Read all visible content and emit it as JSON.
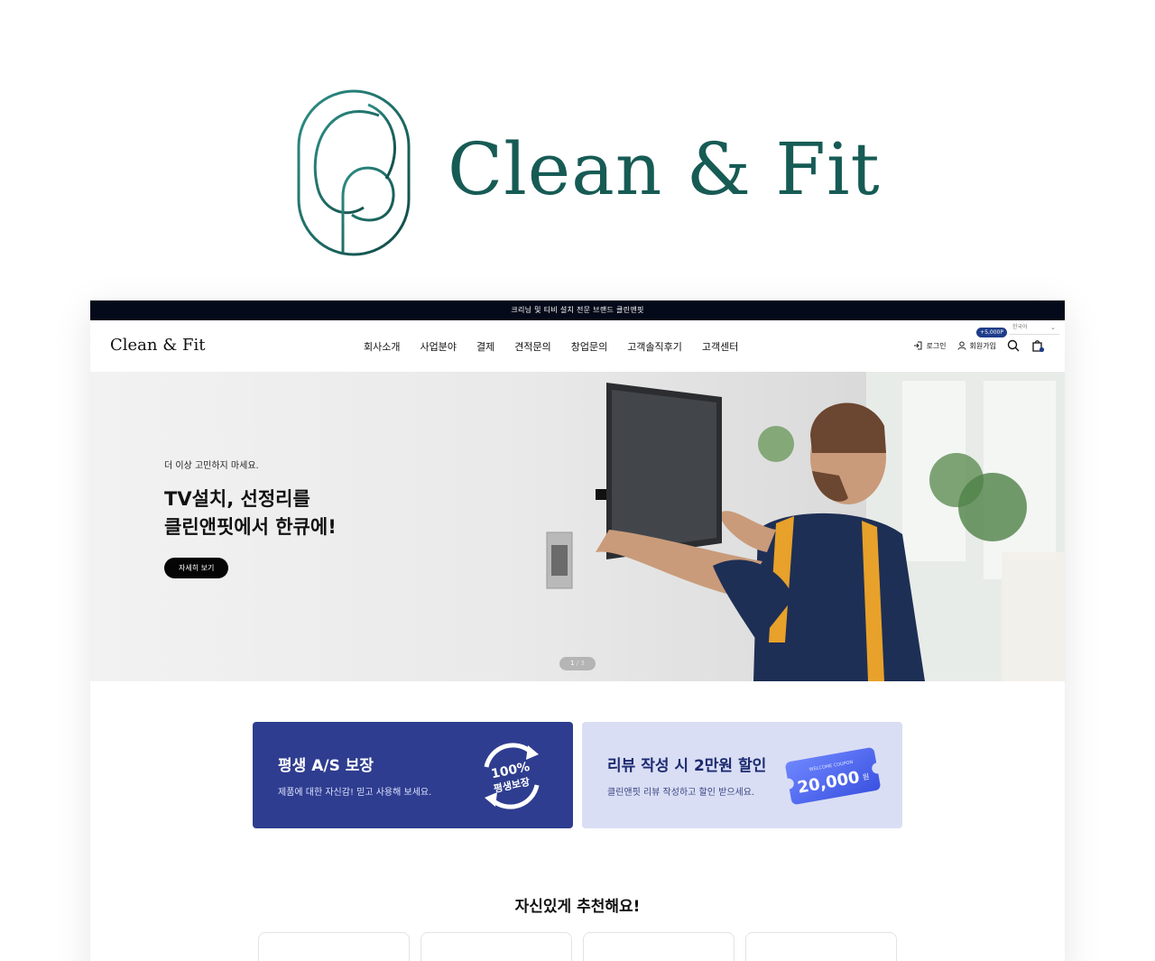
{
  "brand": {
    "wordmark": "Clean & Fit",
    "logo_icon": "cf-monogram-icon",
    "color": "#175b55"
  },
  "site": {
    "topbar": {
      "notice": "크리닝 및 티비 설치 전문 브랜드 클린앤핏"
    },
    "nav": {
      "logo": "Clean & Fit",
      "menu": [
        "회사소개",
        "사업분야",
        "결제",
        "견적문의",
        "창업문의",
        "고객솔직후기",
        "고객센터"
      ],
      "login": "로그인",
      "signup": "회원가입",
      "point_badge": "+5,000P",
      "language": "한국어",
      "icons": [
        "login-icon",
        "user-icon",
        "search-icon",
        "cart-icon"
      ]
    },
    "hero": {
      "subtitle": "더 이상 고민하지 마세요.",
      "title": "TV설치, 선정리를\n클린앤핏에서 한큐에!",
      "button": "자세히 보기",
      "pager_current": "1",
      "pager_sep": " / ",
      "pager_total": "3"
    },
    "promos": [
      {
        "title": "평생 A/S 보장",
        "desc": "제품에 대한 자신감! 믿고 사용해 보세요.",
        "badge_pct": "100%",
        "badge_text": "평생보장",
        "color": "#2e3d8f"
      },
      {
        "title": "리뷰 작성 시 2만원 할인",
        "desc": "클린앤핏 리뷰 작성하고 할인 받으세요.",
        "coupon_label": "WELCOME COUPON",
        "coupon_amount": "20,000",
        "coupon_unit": "원",
        "color": "#d9def4"
      }
    ],
    "recommend": {
      "title": "자신있게 추천해요!",
      "card_count": 4
    }
  }
}
